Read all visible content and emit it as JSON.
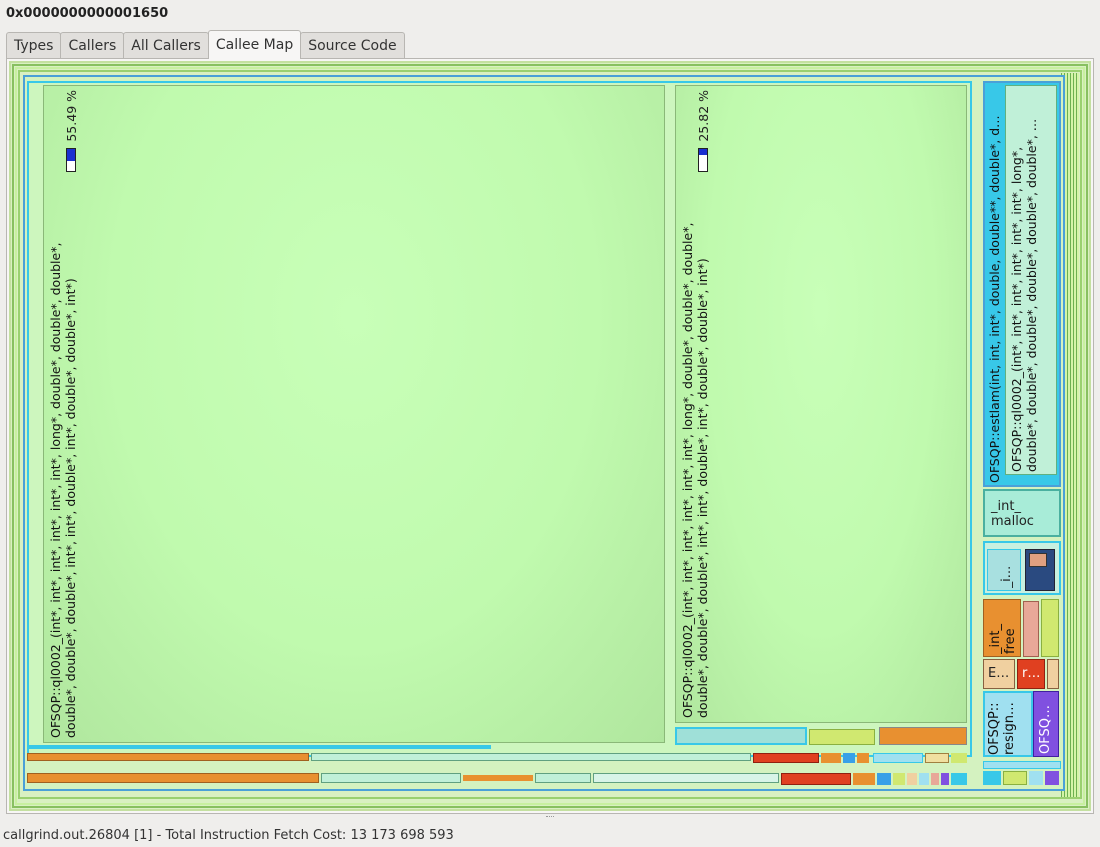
{
  "window": {
    "title": "0x0000000000001650"
  },
  "tabs": [
    {
      "label": "Types",
      "active": false
    },
    {
      "label": "Callers",
      "active": false
    },
    {
      "label": "All Callers",
      "active": false
    },
    {
      "label": "Callee Map",
      "active": true
    },
    {
      "label": "Source Code",
      "active": false
    }
  ],
  "treemap": {
    "main_block": {
      "label_line1": "OFSQP::ql0002_(int*, int*, int*, int*, int*, int*, long*, double*, double*, double*,",
      "label_line2": "double*, double*, double*, int*, int*, double*, int*, double*, double*, int*)",
      "percent_text": "55.49 %",
      "percent": 55.49
    },
    "second_block": {
      "label_line1": "OFSQP::ql0002_(int*, int*, int*, int*, int*, int*, long*, double*, double*, double*,",
      "label_line2": "double*, double*, double*, int*, int*, double*, int*, double*, double*, int*)",
      "percent_text": "25.82 %",
      "percent": 25.82
    },
    "estlam_block": {
      "label": "OFSQP::estlam(int, int, int*, double, double**, double*, d…"
    },
    "ql0002_small_block": {
      "label_line1": "OFSQP::ql0002_(int*, int*, int*, int*, int*, int*, long*,",
      "label_line2": "double*, double*, double*, double*, double*, double*, …"
    },
    "malloc_block": {
      "label_line1": "_int_",
      "label_line2": "malloc"
    },
    "small_i_block": {
      "label": "_i…"
    },
    "free_block": {
      "label_line1": "_int_",
      "label_line2": "free"
    },
    "e_block": {
      "label": "E…"
    },
    "r_block": {
      "label": "r…"
    },
    "resign_block": {
      "label_line1": "OFSQP::",
      "label_line2": "resign…"
    },
    "ofsq_block": {
      "label": "OFSQ…"
    },
    "colors": {
      "green": "#c2fbb0",
      "cyan": "#38c8e8",
      "orange": "#e89030",
      "red": "#e04020",
      "purple": "#8050e0",
      "yellow": "#d0e870"
    }
  },
  "status": {
    "text": "callgrind.out.26804 [1] - Total Instruction Fetch Cost: 13 173 698 593"
  }
}
